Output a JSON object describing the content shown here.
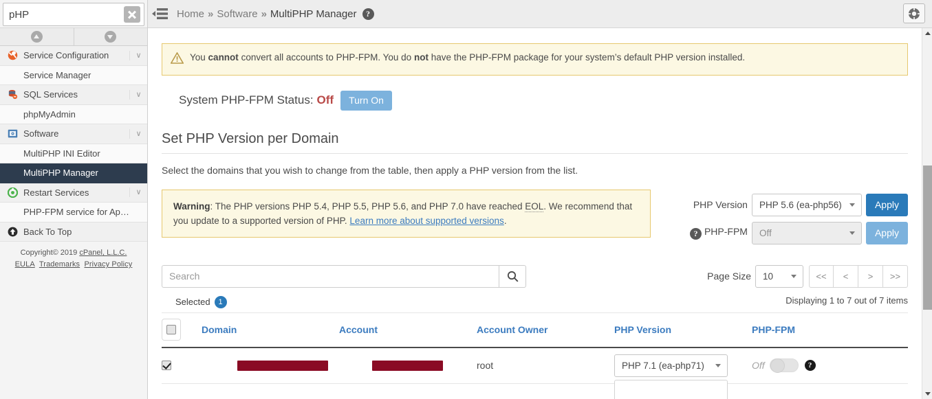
{
  "sidebar": {
    "search": {
      "value": "pHP",
      "placeholder": "",
      "clear_icon": "clear-x-icon"
    },
    "nav_up_icon": "circle-up-arrow-icon",
    "nav_down_icon": "circle-down-arrow-icon",
    "items": [
      {
        "label": "Service Configuration",
        "type": "group",
        "icon": "wrench-tools-icon",
        "chevron": "∨"
      },
      {
        "label": "Service Manager",
        "type": "leaf",
        "icon": "",
        "chevron": ""
      },
      {
        "label": "SQL Services",
        "type": "group",
        "icon": "database-icon",
        "chevron": "∨"
      },
      {
        "label": "phpMyAdmin",
        "type": "leaf",
        "icon": "",
        "chevron": ""
      },
      {
        "label": "Software",
        "type": "group",
        "icon": "software-box-icon",
        "chevron": "∨"
      },
      {
        "label": "MultiPHP INI Editor",
        "type": "leaf",
        "icon": "",
        "chevron": ""
      },
      {
        "label": "MultiPHP Manager",
        "type": "leaf-active",
        "icon": "",
        "chevron": ""
      },
      {
        "label": "Restart Services",
        "type": "group",
        "icon": "restart-circle-icon",
        "chevron": "∨"
      },
      {
        "label": "PHP-FPM service for Apache",
        "type": "leaf",
        "icon": "",
        "chevron": ""
      },
      {
        "label": "Back To Top",
        "type": "group",
        "icon": "up-arrow-circle-icon",
        "chevron": ""
      }
    ],
    "footer": {
      "copyright": "Copyright© 2019 ",
      "cpanel_link": "cPanel, L.L.C.",
      "eula": "EULA",
      "trademarks": "Trademarks",
      "privacy": "Privacy Policy"
    }
  },
  "topbar": {
    "menu_icon": "collapse-sidebar-icon",
    "breadcrumb": [
      {
        "label": "Home",
        "current": false
      },
      {
        "label": "Software",
        "current": false
      },
      {
        "label": "MultiPHP Manager",
        "current": true
      }
    ],
    "separator": "»",
    "help_icon": "question-mark-icon",
    "close_button_icon": "lifesaver-icon"
  },
  "alert": {
    "icon": "warning-triangle-icon",
    "p1": "You ",
    "b1": "cannot",
    "p2": " convert all accounts to PHP-FPM. You do ",
    "b2": "not",
    "p3": " have the PHP-FPM package for your system’s default PHP version installed."
  },
  "system_status": {
    "label": "System PHP-FPM Status:",
    "value": "Off",
    "button": "Turn On"
  },
  "section": {
    "title": "Set PHP Version per Domain",
    "description": "Select the domains that you wish to change from the table, then apply a PHP version from the list."
  },
  "warning2": {
    "bold": "Warning",
    "text1": ": The PHP versions PHP 5.4, PHP 5.5, PHP 5.6, and PHP 7.0 have reached ",
    "eol": "EOL",
    "text2": ". We recommend that you update to a supported version of PHP. ",
    "link": "Learn more about supported versions",
    "text3": "."
  },
  "controls": {
    "php_version_label": "PHP Version",
    "php_version_value": "PHP 5.6 (ea-php56)",
    "php_version_apply": "Apply",
    "fpm_label": "PHP-FPM",
    "fpm_help_icon": "question-mark-icon",
    "fpm_value": "Off",
    "fpm_apply": "Apply"
  },
  "toolbar": {
    "search_placeholder": "Search",
    "search_value": "",
    "search_icon": "magnifier-icon",
    "selected_label": "Selected",
    "selected_count": "1",
    "page_size_label": "Page Size",
    "page_size_value": "10",
    "pager": [
      "<<",
      "<",
      ">",
      ">>"
    ],
    "displaying": "Displaying 1 to 7 out of 7 items"
  },
  "table": {
    "columns": [
      "Domain",
      "Account",
      "Account Owner",
      "PHP Version",
      "PHP-FPM"
    ],
    "header_checkbox_checked": false,
    "rows": [
      {
        "checked": true,
        "domain": "",
        "domain_redacted": true,
        "account": "",
        "account_redacted": true,
        "account_owner": "root",
        "php_version": "PHP 7.1 (ea-php71)",
        "fpm_state": "Off",
        "fpm_help_icon": "question-mark-icon"
      }
    ]
  },
  "scrollbar": {
    "up_icon": "scroll-up-arrow-icon",
    "down_icon": "scroll-down-arrow-icon"
  },
  "colors": {
    "accent": "#2a7ab9",
    "active_nav": "#2d3c4e",
    "warning_bg": "#fcf8e3",
    "warning_border": "#e6c86e",
    "status_off": "#b94a48",
    "redaction": "#8a0b24",
    "link": "#3b7bbf"
  }
}
